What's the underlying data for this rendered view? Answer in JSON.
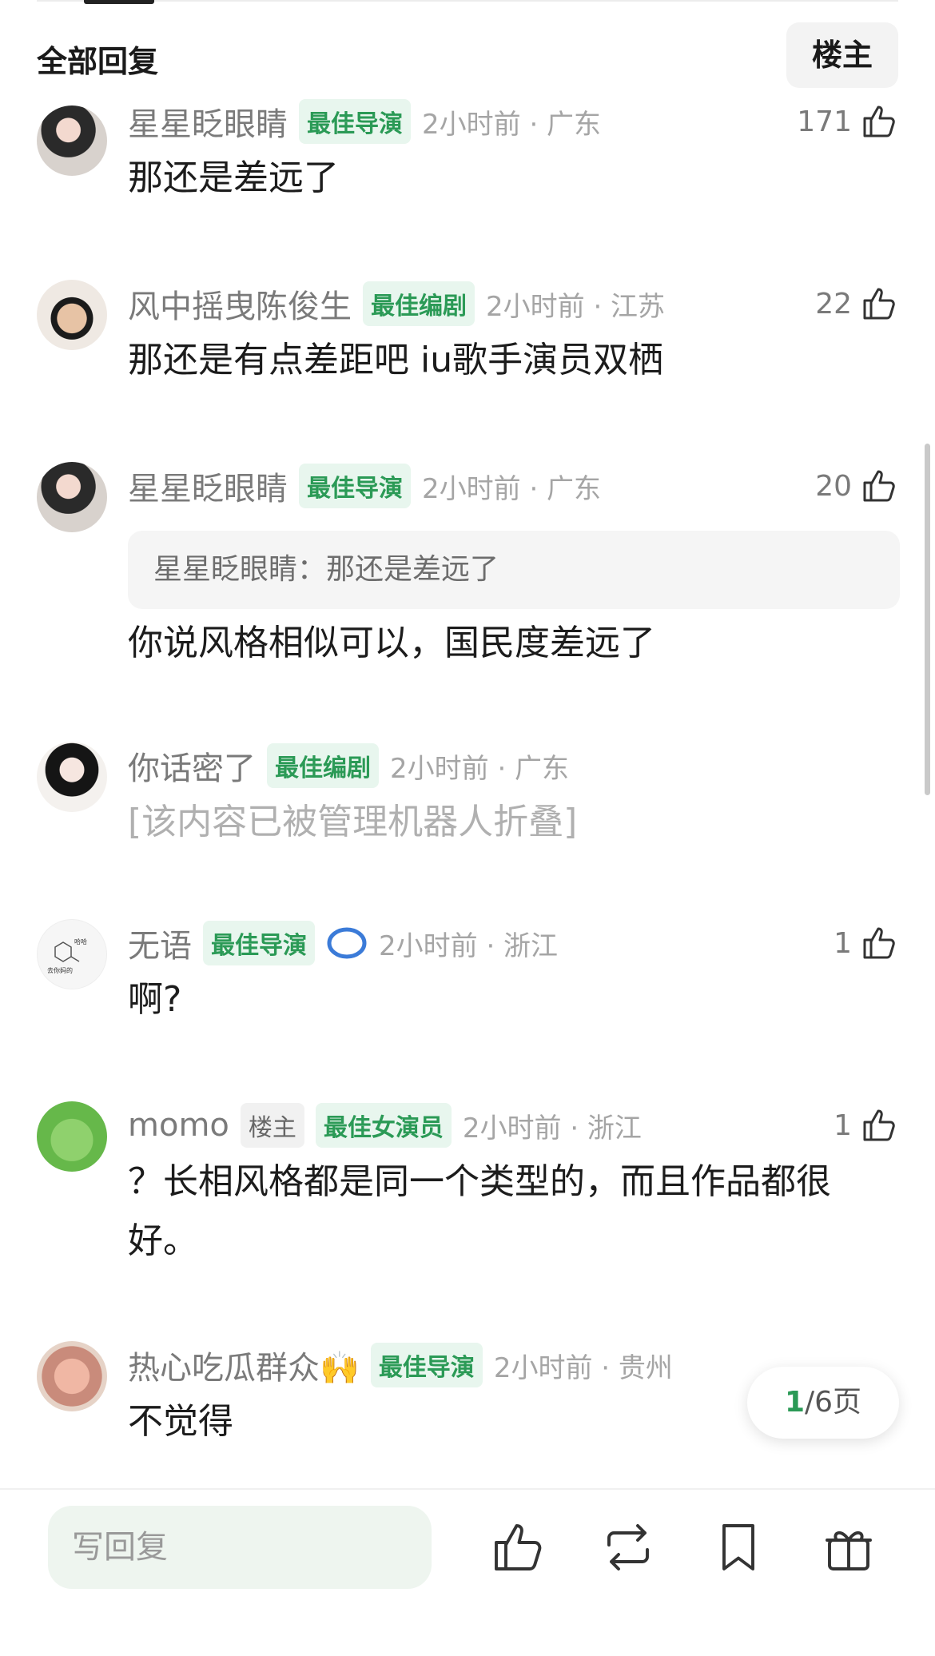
{
  "header": {
    "title": "全部回复",
    "owner_button": "楼主"
  },
  "comments": [
    {
      "user": "星星眨眼睛",
      "tag": "最佳导演",
      "time": "2小时前 · 广东",
      "likes": "171",
      "text": "那还是差远了"
    },
    {
      "user": "风中摇曳陈俊生",
      "tag": "最佳编剧",
      "time": "2小时前 · 江苏",
      "likes": "22",
      "text": "那还是有点差距吧 iu歌手演员双栖"
    },
    {
      "user": "星星眨眼睛",
      "tag": "最佳导演",
      "time": "2小时前 · 广东",
      "likes": "20",
      "quote": "星星眨眼睛：那还是差远了",
      "text": "你说风格相似可以，国民度差远了"
    },
    {
      "user": "你话密了",
      "tag": "最佳编剧",
      "time": "2小时前 · 广东",
      "text": "[该内容已被管理机器人折叠]"
    },
    {
      "user": "无语",
      "tag": "最佳导演",
      "time": "2小时前 · 浙江",
      "likes": "1",
      "text": "啊?"
    },
    {
      "user": "momo",
      "owner_tag": "楼主",
      "tag": "最佳女演员",
      "time": "2小时前 · 浙江",
      "likes": "1",
      "text": "？长相风格都是同一个类型的，而且作品都很好。"
    },
    {
      "user": "热心吃瓜群众🙌",
      "tag": "最佳导演",
      "time": "2小时前 · 贵州",
      "text": "不觉得"
    }
  ],
  "pager": {
    "current": "1",
    "total": "/6页"
  },
  "bottom": {
    "reply_placeholder": "写回复"
  },
  "icons": {
    "like": "thumb-up-icon",
    "share": "repost-icon",
    "bookmark": "bookmark-icon",
    "gift": "gift-icon"
  },
  "colors": {
    "accent_green": "#2b9a56",
    "tag_bg": "#e8f6ee"
  }
}
